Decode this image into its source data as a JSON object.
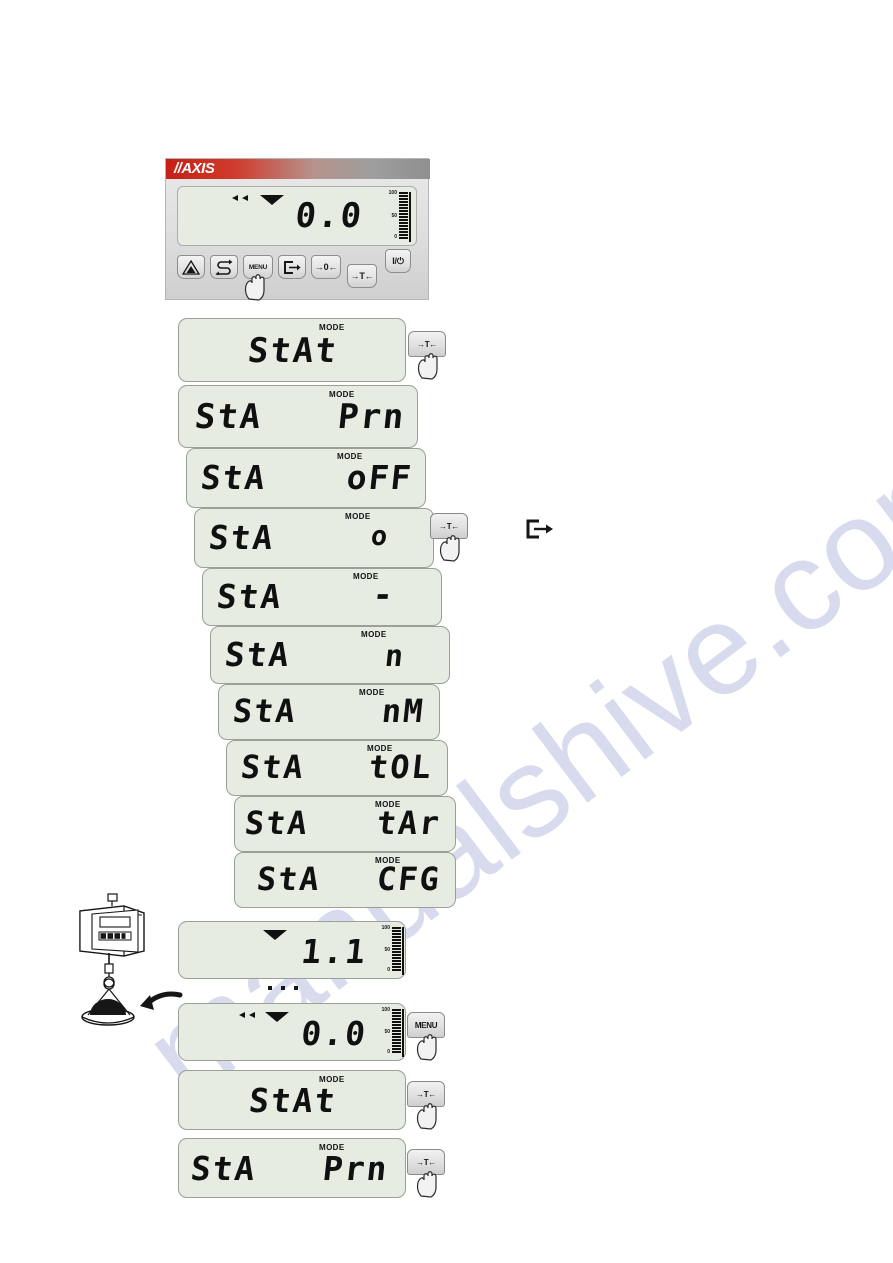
{
  "document": {
    "type": "scale-operating-manual-figure",
    "watermark": "manualshive.com"
  },
  "device": {
    "brand_logo": "//AXIS",
    "display": {
      "value": "0.0",
      "stability_markers": [
        "arrow-marker",
        "arrow-marker",
        "stable-marker"
      ],
      "bargraph": {
        "labels": [
          "100",
          "50",
          "0"
        ],
        "percent": 0
      }
    },
    "keys": [
      {
        "name": "calibration-key",
        "label": "CAL"
      },
      {
        "name": "unit-switch-key",
        "label": "S-arrow"
      },
      {
        "name": "menu-key",
        "label": "MENU"
      },
      {
        "name": "print-key",
        "label": "print"
      },
      {
        "name": "zero-key",
        "label": "→0←"
      },
      {
        "name": "tare-key",
        "label": "→T←"
      },
      {
        "name": "power-key",
        "label": "I/⏻"
      }
    ],
    "pressed_key": "MENU"
  },
  "menu_sequence": [
    {
      "id": "stat",
      "left_text": "StAt",
      "right_text": "",
      "mode_label": "MODE"
    },
    {
      "id": "sta-prn",
      "left_text": "StA",
      "right_text": "Prn",
      "mode_label": "MODE"
    },
    {
      "id": "sta-off",
      "left_text": "StA",
      "right_text": "oFF",
      "mode_label": "MODE"
    },
    {
      "id": "sta-o",
      "left_text": "StA",
      "right_text": "o",
      "mode_label": "MODE"
    },
    {
      "id": "sta-dash",
      "left_text": "StA",
      "right_text": "-",
      "mode_label": "MODE"
    },
    {
      "id": "sta-n",
      "left_text": "StA",
      "right_text": "n",
      "mode_label": "MODE"
    },
    {
      "id": "sta-nm",
      "left_text": "StA",
      "right_text": "nM",
      "mode_label": "MODE"
    },
    {
      "id": "sta-tol",
      "left_text": "StA",
      "right_text": "tOL",
      "mode_label": "MODE"
    },
    {
      "id": "sta-tar",
      "left_text": "StA",
      "right_text": "tAr",
      "mode_label": "MODE"
    },
    {
      "id": "sta-cfg",
      "left_text": "StA",
      "right_text": "CFG",
      "mode_label": "MODE"
    }
  ],
  "callouts": {
    "tare_top": {
      "label": "→T←"
    },
    "tare_middle": {
      "label": "→T←"
    },
    "print_icon": {
      "name": "print-icon"
    },
    "menu_bottom": {
      "label": "MENU"
    },
    "tare_b1": {
      "label": "→T←"
    },
    "tare_b2": {
      "label": "→T←"
    }
  },
  "weighing_results": {
    "loaded": {
      "value": "1.1",
      "stability_markers": [
        "stable-marker"
      ],
      "bargraph": {
        "labels": [
          "100",
          "50",
          "0"
        ],
        "percent": 18
      }
    },
    "separator_dots": "▪ ▪ ▪",
    "zeroed": {
      "value": "0.0",
      "stability_markers": [
        "arrow-marker",
        "arrow-marker",
        "stable-marker"
      ],
      "bargraph": {
        "labels": [
          "100",
          "50",
          "0"
        ],
        "percent": 0
      }
    }
  },
  "bottom_sequence": [
    {
      "id": "stat-2",
      "left_text": "StAt",
      "right_text": "",
      "mode_label": "MODE"
    },
    {
      "id": "sta-prn-2",
      "left_text": "StA",
      "right_text": "Prn",
      "mode_label": "MODE"
    }
  ],
  "illustration": {
    "name": "hanging-scale-with-load",
    "caption": ""
  },
  "colors": {
    "lcd_background": "#e7ece3",
    "lcd_border": "#9aa096",
    "segment": "#101010",
    "logo_red": "#c62016",
    "key_face": "#e2e2e2",
    "watermark": "#b9bce0"
  }
}
